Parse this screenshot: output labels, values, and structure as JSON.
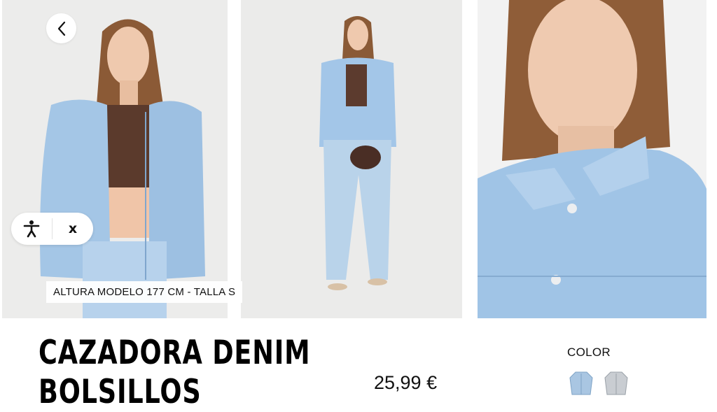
{
  "gallery": {
    "model_info": "ALTURA MODELO 177 CM - TALLA S",
    "close_label": "x"
  },
  "product": {
    "title_line1": "CAZADORA DENIM",
    "title_line2": "BOLSILLOS",
    "price": "25,99 €"
  },
  "color_section": {
    "label": "COLOR",
    "swatches": [
      {
        "name": "light-blue",
        "color": "#a9c6e2"
      },
      {
        "name": "grey",
        "color": "#c9cdd2"
      }
    ]
  },
  "icons": {
    "back": "chevron-left-icon",
    "accessibility": "accessibility-person-icon"
  },
  "colors": {
    "text": "#111111",
    "denim": "#9fc3e4",
    "photo_background": "#ececec"
  }
}
